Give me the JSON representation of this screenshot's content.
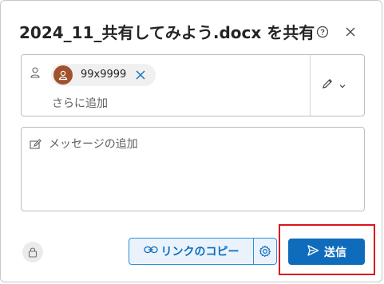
{
  "dialog": {
    "title": "2024_11_共有してみよう.docx を共有",
    "help_icon": "help-circle-icon",
    "close_icon": "close-icon"
  },
  "recipients": {
    "field_icon": "person-icon",
    "chips": [
      {
        "name": "99x9999",
        "avatar_color": "#a0522d"
      }
    ],
    "add_more_label": "さらに追加",
    "permission_icon": "pencil-icon"
  },
  "message": {
    "placeholder": "メッセージの追加",
    "icon": "edit-icon"
  },
  "footer": {
    "lock_icon": "lock-icon",
    "copy_link_label": "リンクのコピー",
    "settings_icon": "gear-icon",
    "send_label": "送信",
    "accent_color": "#0f6cbd",
    "highlight_color": "#d9151c"
  }
}
